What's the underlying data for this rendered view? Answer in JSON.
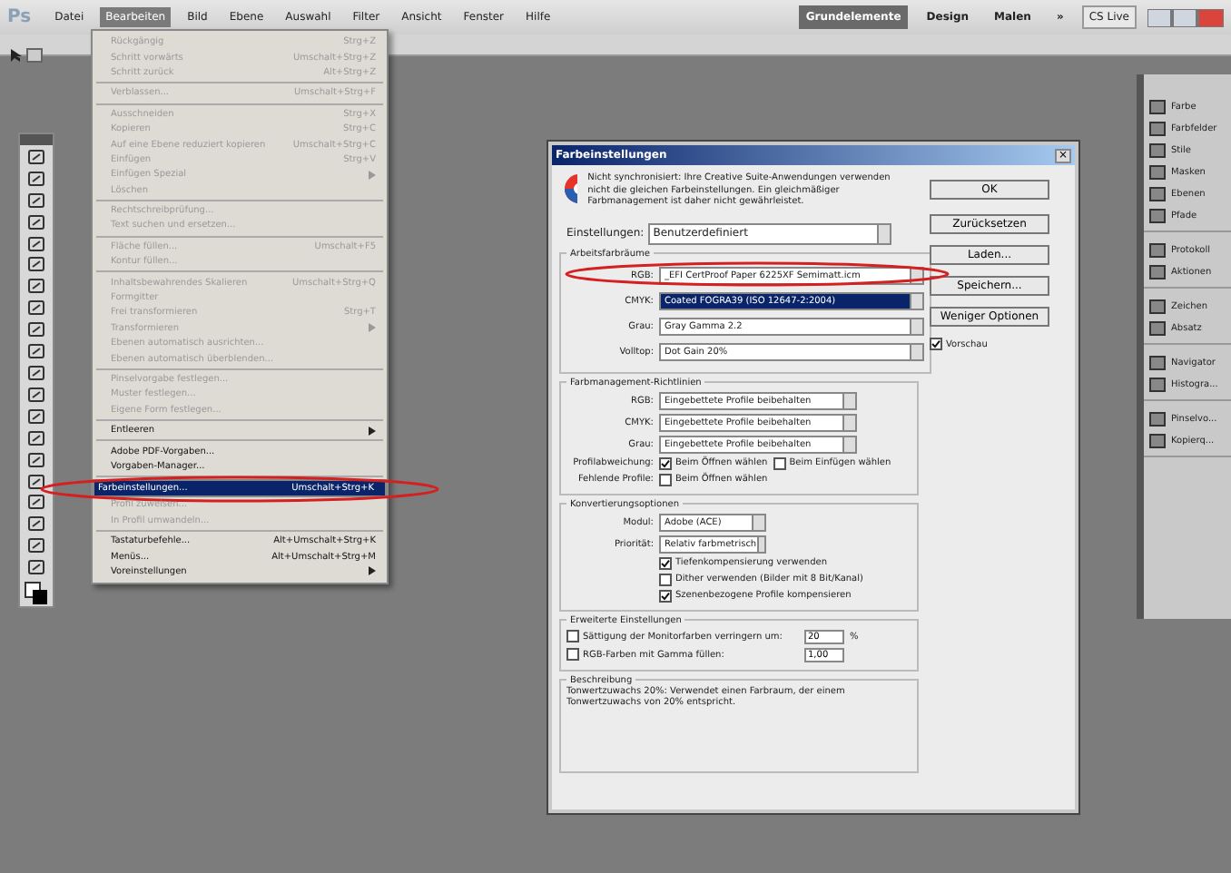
{
  "app": {
    "logo": "Ps",
    "menu": [
      {
        "label": "Datei",
        "selected": false
      },
      {
        "label": "Bearbeiten",
        "selected": true
      },
      {
        "label": "Bild",
        "selected": false
      },
      {
        "label": "Ebene",
        "selected": false
      },
      {
        "label": "Auswahl",
        "selected": false
      },
      {
        "label": "Filter",
        "selected": false
      },
      {
        "label": "Ansicht",
        "selected": false
      },
      {
        "label": "Fenster",
        "selected": false
      },
      {
        "label": "Hilfe",
        "selected": false
      }
    ],
    "workspaces": [
      {
        "label": "Grundelemente",
        "selected": true
      },
      {
        "label": "Design",
        "selected": false
      },
      {
        "label": "Malen",
        "selected": false
      }
    ],
    "more": "»",
    "cs_live": "CS Live"
  },
  "edit_menu": [
    {
      "kind": "item",
      "label": "Rückgängig",
      "shortcut": "Strg+Z",
      "disabled": true
    },
    {
      "kind": "item",
      "label": "Schritt vorwärts",
      "shortcut": "Umschalt+Strg+Z",
      "disabled": true
    },
    {
      "kind": "item",
      "label": "Schritt zurück",
      "shortcut": "Alt+Strg+Z",
      "disabled": true
    },
    {
      "kind": "separator"
    },
    {
      "kind": "item",
      "label": "Verblassen...",
      "shortcut": "Umschalt+Strg+F",
      "disabled": true
    },
    {
      "kind": "separator"
    },
    {
      "kind": "item",
      "label": "Ausschneiden",
      "shortcut": "Strg+X",
      "disabled": true
    },
    {
      "kind": "item",
      "label": "Kopieren",
      "shortcut": "Strg+C",
      "disabled": true
    },
    {
      "kind": "item",
      "label": "Auf eine Ebene reduziert kopieren",
      "shortcut": "Umschalt+Strg+C",
      "disabled": true
    },
    {
      "kind": "item",
      "label": "Einfügen",
      "shortcut": "Strg+V",
      "disabled": true
    },
    {
      "kind": "submenu",
      "label": "Einfügen Spezial",
      "disabled": true
    },
    {
      "kind": "item",
      "label": "Löschen",
      "disabled": true
    },
    {
      "kind": "separator"
    },
    {
      "kind": "item",
      "label": "Rechtschreibprüfung...",
      "disabled": true
    },
    {
      "kind": "item",
      "label": "Text suchen und ersetzen...",
      "disabled": true
    },
    {
      "kind": "separator"
    },
    {
      "kind": "item",
      "label": "Fläche füllen...",
      "shortcut": "Umschalt+F5",
      "disabled": true
    },
    {
      "kind": "item",
      "label": "Kontur füllen...",
      "disabled": true
    },
    {
      "kind": "separator"
    },
    {
      "kind": "item",
      "label": "Inhaltsbewahrendes Skalieren",
      "shortcut": "Umschalt+Strg+Q",
      "disabled": true
    },
    {
      "kind": "item",
      "label": "Formgitter",
      "disabled": true
    },
    {
      "kind": "item",
      "label": "Frei transformieren",
      "shortcut": "Strg+T",
      "disabled": true
    },
    {
      "kind": "submenu",
      "label": "Transformieren",
      "disabled": true
    },
    {
      "kind": "item",
      "label": "Ebenen automatisch ausrichten...",
      "disabled": true
    },
    {
      "kind": "item",
      "label": "Ebenen automatisch überblenden...",
      "disabled": true
    },
    {
      "kind": "separator"
    },
    {
      "kind": "item",
      "label": "Pinselvorgabe festlegen...",
      "disabled": true
    },
    {
      "kind": "item",
      "label": "Muster festlegen...",
      "disabled": true
    },
    {
      "kind": "item",
      "label": "Eigene Form festlegen...",
      "disabled": true
    },
    {
      "kind": "separator"
    },
    {
      "kind": "submenu",
      "label": "Entleeren",
      "disabled": false
    },
    {
      "kind": "separator"
    },
    {
      "kind": "item",
      "label": "Adobe PDF-Vorgaben...",
      "disabled": false
    },
    {
      "kind": "item",
      "label": "Vorgaben-Manager...",
      "disabled": false
    },
    {
      "kind": "separator"
    },
    {
      "kind": "item",
      "label": "Farbeinstellungen...",
      "shortcut": "Umschalt+Strg+K",
      "disabled": false,
      "selected": true,
      "annotated": true
    },
    {
      "kind": "item",
      "label": "Profil zuweisen...",
      "disabled": true
    },
    {
      "kind": "item",
      "label": "In Profil umwandeln...",
      "disabled": true
    },
    {
      "kind": "separator"
    },
    {
      "kind": "item",
      "label": "Tastaturbefehle...",
      "shortcut": "Alt+Umschalt+Strg+K",
      "disabled": false
    },
    {
      "kind": "item",
      "label": "Menüs...",
      "shortcut": "Alt+Umschalt+Strg+M",
      "disabled": false
    },
    {
      "kind": "submenu",
      "label": "Voreinstellungen",
      "disabled": false
    }
  ],
  "dialog": {
    "title": "Farbeinstellungen",
    "close": "×",
    "notice": "Nicht synchronisiert: Ihre Creative Suite-Anwendungen verwenden nicht die gleichen Farbeinstellungen. Ein gleichmäßiger Farbmanagement ist daher nicht gewährleistet.",
    "settings": {
      "label": "Einstellungen:",
      "value": "Benutzerdefiniert"
    },
    "working_spaces": {
      "title": "Arbeitsfarbräume",
      "rows": [
        {
          "label": "RGB:",
          "value": "_EFI CertProof Paper 6225XF Semimatt.icm",
          "selected": false,
          "annotated": true
        },
        {
          "label": "CMYK:",
          "value": "Coated FOGRA39 (ISO 12647-2:2004)",
          "selected": true
        },
        {
          "label": "Grau:",
          "value": "Gray Gamma 2.2",
          "selected": false
        },
        {
          "label": "Volltop:",
          "value": "Dot Gain 20%",
          "selected": false
        }
      ]
    },
    "policies": {
      "title": "Farbmanagement-Richtlinien",
      "rows": [
        {
          "label": "RGB:",
          "value": "Eingebettete Profile beibehalten"
        },
        {
          "label": "CMYK:",
          "value": "Eingebettete Profile beibehalten"
        },
        {
          "label": "Grau:",
          "value": "Eingebettete Profile beibehalten"
        }
      ],
      "mismatch": {
        "label": "Profilabweichung:",
        "options": [
          {
            "label": "Beim Öffnen wählen",
            "checked": true
          },
          {
            "label": "Beim Einfügen wählen",
            "checked": false
          }
        ]
      },
      "missing": {
        "label": "Fehlende Profile:",
        "options": [
          {
            "label": "Beim Öffnen wählen",
            "checked": false
          }
        ]
      }
    },
    "conversion": {
      "title": "Konvertierungsoptionen",
      "rows": [
        {
          "label": "Modul:",
          "value": "Adobe (ACE)"
        },
        {
          "label": "Priorität:",
          "value": "Relativ farbmetrisch"
        }
      ],
      "options": [
        {
          "label": "Tiefenkompensierung verwenden",
          "checked": true
        },
        {
          "label": "Dither verwenden (Bilder mit 8 Bit/Kanal)",
          "checked": false
        },
        {
          "label": "Szenenbezogene Profile kompensieren",
          "checked": true
        }
      ]
    },
    "advanced": {
      "title": "Erweiterte Einstellungen",
      "rows": [
        {
          "label": "Sättigung der Monitorfarben verringern um:",
          "value": "20",
          "unit": "%",
          "checked": false
        },
        {
          "label": "RGB-Farben mit Gamma füllen:",
          "value": "1,00",
          "checked": false
        }
      ]
    },
    "description": {
      "title": "Beschreibung",
      "text": "Tonwertzuwachs 20%: Verwendet einen Farbraum, der einem Tonwertzuwachs von 20% entspricht."
    },
    "buttons": [
      "OK",
      "Zurücksetzen",
      "Laden...",
      "Speichern...",
      "Weniger Optionen"
    ],
    "preview": {
      "label": "Vorschau",
      "checked": true
    }
  },
  "panels": [
    [
      "Farbe",
      "Farbfelder",
      "Stile",
      "Masken",
      "Ebenen",
      "Pfade"
    ],
    [
      "Protokoll",
      "Aktionen"
    ],
    [
      "Zeichen",
      "Absatz"
    ],
    [
      "Navigator",
      "Histogra..."
    ],
    [
      "Pinselvo...",
      "Kopierq..."
    ]
  ]
}
